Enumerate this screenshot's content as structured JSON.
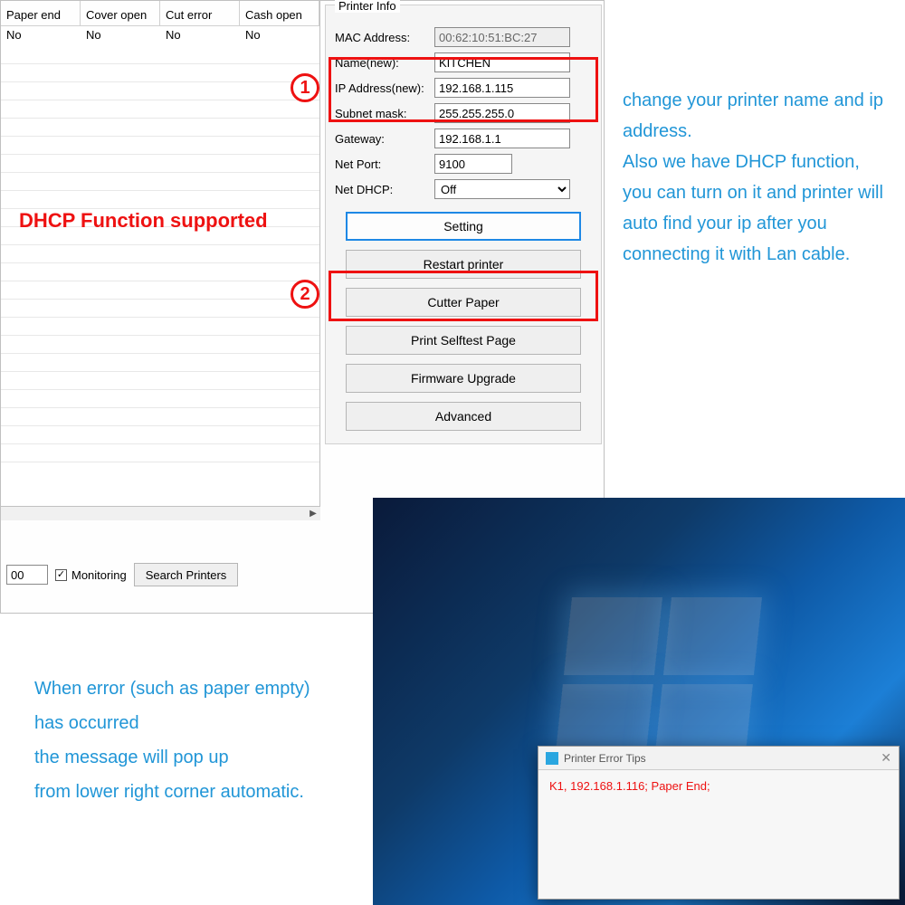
{
  "table": {
    "headers": [
      "Paper end",
      "Cover open",
      "Cut error",
      "Cash open"
    ],
    "row": [
      "No",
      "No",
      "No",
      "No"
    ]
  },
  "bottom": {
    "num_value": "00",
    "monitoring_label": "Monitoring",
    "search_label": "Search Printers"
  },
  "panel": {
    "title": "Printer Info",
    "mac_label": "MAC Address:",
    "mac_value": "00:62:10:51:BC:27",
    "name_label": "Name(new):",
    "name_value": "KITCHEN",
    "ip_label": "IP Address(new):",
    "ip_value": "192.168.1.115",
    "subnet_label": "Subnet mask:",
    "subnet_value": "255.255.255.0",
    "gateway_label": "Gateway:",
    "gateway_value": "192.168.1.1",
    "port_label": "Net Port:",
    "port_value": "9100",
    "dhcp_label": "Net DHCP:",
    "dhcp_value": "Off",
    "btn_setting": "Setting",
    "btn_restart": "Restart printer",
    "btn_cutter": "Cutter Paper",
    "btn_selftest": "Print Selftest Page",
    "btn_firmware": "Firmware Upgrade",
    "btn_advanced": "Advanced"
  },
  "annotations": {
    "marker1": "1",
    "marker2": "2",
    "dhcp_note": "DHCP Function supported",
    "right_text": "change your printer name and ip address.\nAlso we have DHCP function, you can turn on it and printer will auto find your ip after you connecting it with Lan cable.",
    "bottom_text": "When error (such as paper empty)\nhas occurred\nthe message will pop up\nfrom lower right corner automatic."
  },
  "popup": {
    "title": "Printer Error Tips",
    "message": "K1, 192.168.1.116; Paper End;"
  }
}
